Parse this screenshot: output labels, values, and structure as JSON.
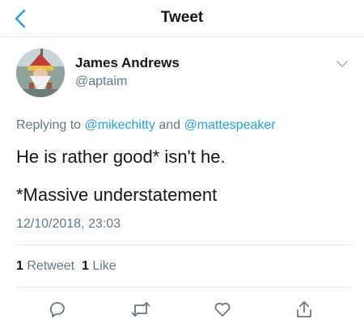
{
  "header": {
    "title": "Tweet",
    "back_icon": "chevron-left-icon"
  },
  "author": {
    "name": "James Andrews",
    "handle": "@aptaim",
    "avatar": "garden-gnome-photo"
  },
  "reply": {
    "prefix": "Replying to ",
    "mention1": "@mikechitty",
    "conjunction": " and ",
    "mention2": "@mattespeaker"
  },
  "tweet": {
    "lines": [
      "He is rather good* isn't he.",
      "*Massive understatement"
    ],
    "timestamp": "12/10/2018, 23:03"
  },
  "stats": {
    "retweets_count": "1",
    "retweets_label": "Retweet",
    "likes_count": "1",
    "likes_label": "Like"
  },
  "actions": [
    "reply-icon",
    "retweet-icon",
    "like-icon",
    "share-icon"
  ],
  "colors": {
    "accent": "#1da1f2",
    "secondary_text": "#657786",
    "divider": "#e1e8ed"
  }
}
